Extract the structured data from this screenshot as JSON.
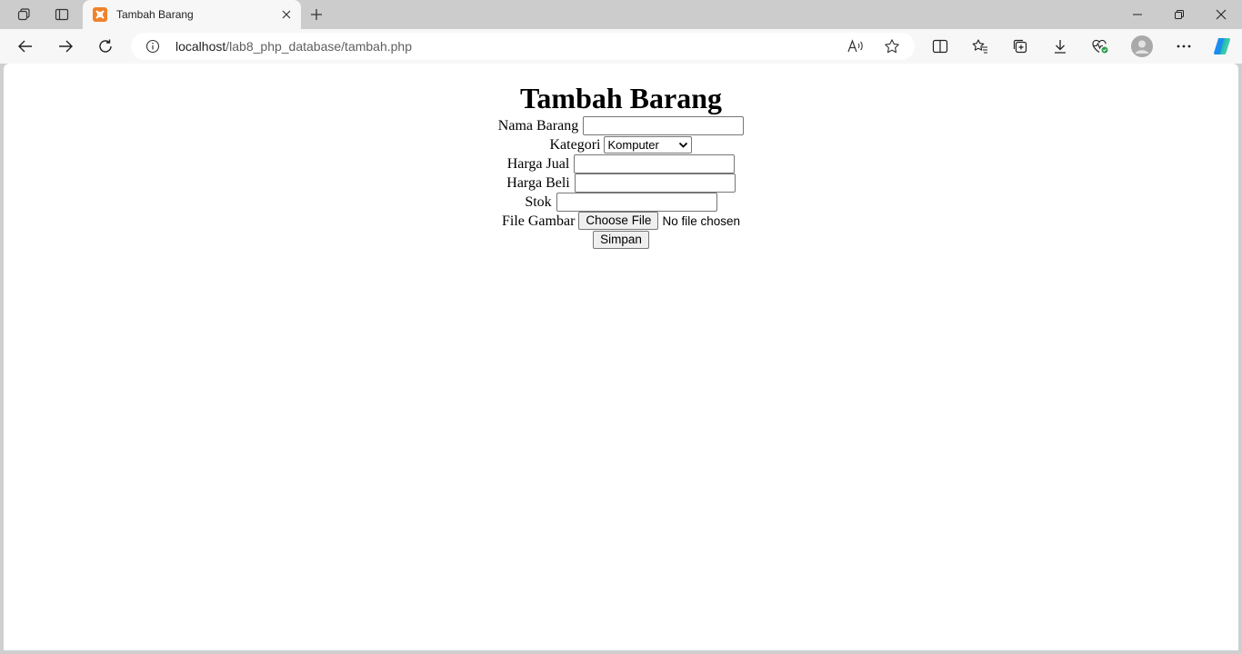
{
  "browser": {
    "tab": {
      "title": "Tambah Barang"
    },
    "address": {
      "host": "localhost",
      "path": "/lab8_php_database/tambah.php"
    },
    "icons": {
      "workspaces": "workspaces-icon",
      "tab_actions": "tab-actions-icon",
      "favicon": "xampp-icon",
      "close_tab": "close-icon",
      "new_tab": "plus-icon",
      "back": "arrow-left-icon",
      "forward": "arrow-right-icon",
      "refresh": "refresh-icon",
      "site_info": "info-icon",
      "read_aloud": "read-aloud-icon",
      "favorite": "star-icon",
      "split_screen": "split-screen-icon",
      "favorites": "favorites-icon",
      "collections": "collections-icon",
      "downloads": "download-icon",
      "browser_essentials": "heart-pulse-icon",
      "profile": "avatar-icon",
      "more": "ellipsis-icon",
      "copilot": "copilot-icon"
    }
  },
  "page": {
    "heading": "Tambah Barang",
    "form": {
      "nama_label": "Nama Barang",
      "nama_value": "",
      "kategori_label": "Kategori",
      "kategori_selected": "Komputer",
      "harga_jual_label": "Harga Jual",
      "harga_jual_value": "",
      "harga_beli_label": "Harga Beli",
      "harga_beli_value": "",
      "stok_label": "Stok",
      "stok_value": "",
      "file_label": "File Gambar",
      "file_button": "Choose File",
      "file_status": "No file chosen",
      "submit_label": "Simpan"
    }
  }
}
